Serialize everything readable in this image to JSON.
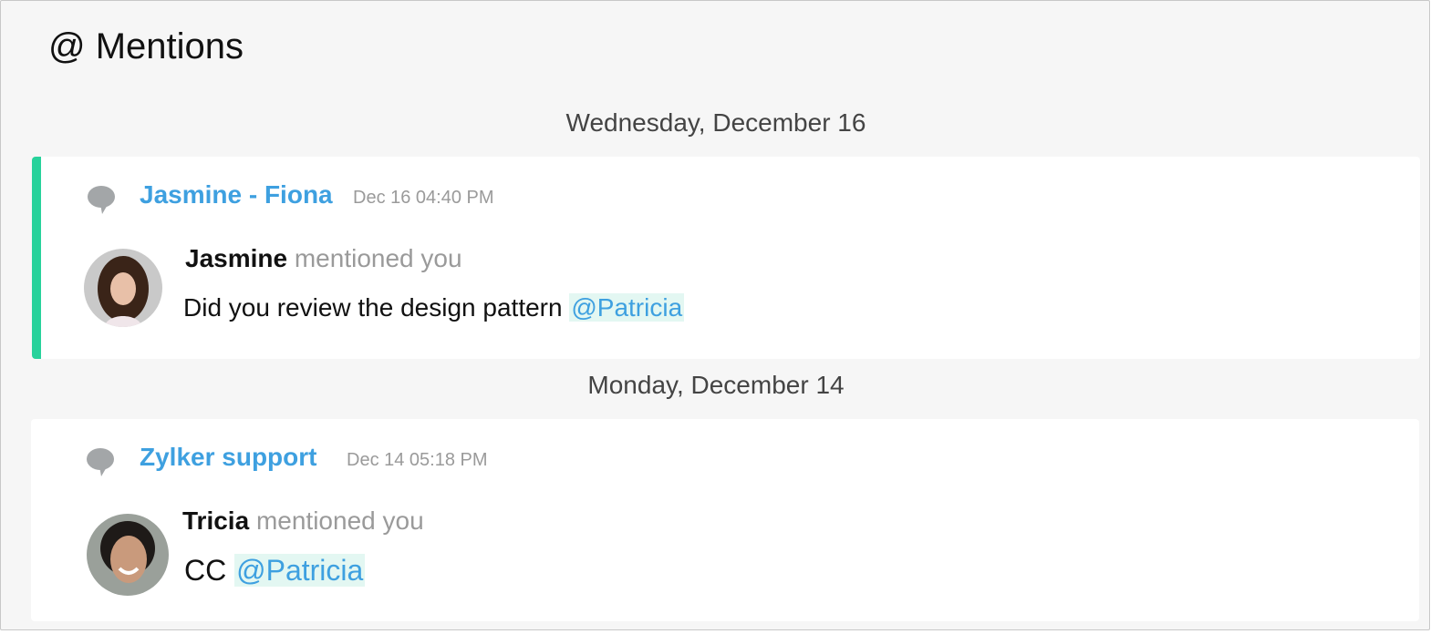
{
  "page": {
    "title": "@ Mentions"
  },
  "groups": [
    {
      "date": "Wednesday, December 16",
      "mention": {
        "chat_name": "Jasmine - Fiona",
        "time": "Dec 16 04:40 PM",
        "sender": "Jasmine",
        "action": "mentioned you",
        "message": "Did you review the design pattern",
        "tag": "@Patricia",
        "unread": true
      }
    },
    {
      "date": "Monday, December 14",
      "mention": {
        "chat_name": "Zylker support",
        "time": "Dec 14 05:18 PM",
        "sender": "Tricia",
        "action": "mentioned you",
        "message": "CC",
        "tag": "@Patricia",
        "unread": false
      }
    }
  ],
  "icons": {
    "chat": "chat-bubble-icon"
  },
  "colors": {
    "accent_unread": "#27d29b",
    "link": "#3ea0e0",
    "mention_bg": "#e3f7f2"
  }
}
